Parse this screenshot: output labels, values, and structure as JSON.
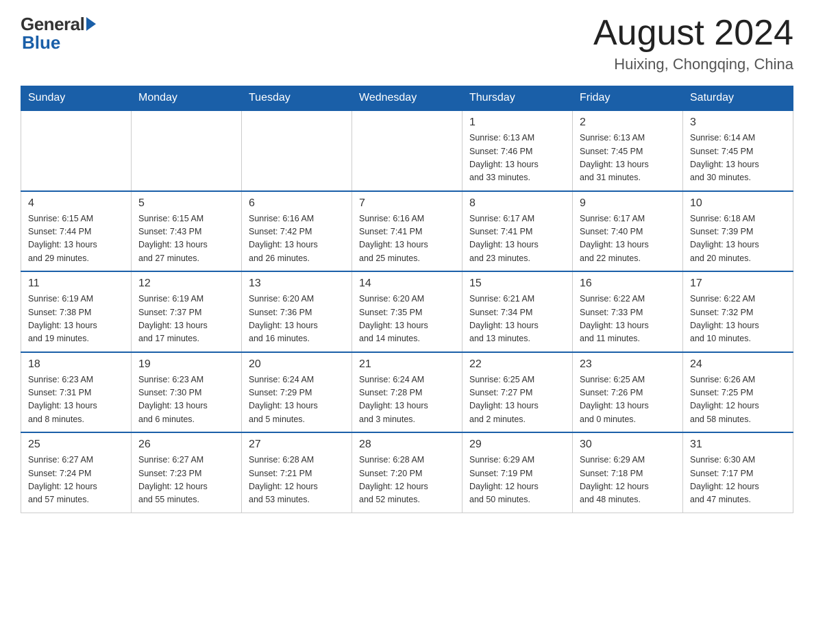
{
  "logo": {
    "general": "General",
    "blue": "Blue"
  },
  "header": {
    "month_year": "August 2024",
    "location": "Huixing, Chongqing, China"
  },
  "weekdays": [
    "Sunday",
    "Monday",
    "Tuesday",
    "Wednesday",
    "Thursday",
    "Friday",
    "Saturday"
  ],
  "weeks": [
    [
      {
        "day": "",
        "info": ""
      },
      {
        "day": "",
        "info": ""
      },
      {
        "day": "",
        "info": ""
      },
      {
        "day": "",
        "info": ""
      },
      {
        "day": "1",
        "info": "Sunrise: 6:13 AM\nSunset: 7:46 PM\nDaylight: 13 hours\nand 33 minutes."
      },
      {
        "day": "2",
        "info": "Sunrise: 6:13 AM\nSunset: 7:45 PM\nDaylight: 13 hours\nand 31 minutes."
      },
      {
        "day": "3",
        "info": "Sunrise: 6:14 AM\nSunset: 7:45 PM\nDaylight: 13 hours\nand 30 minutes."
      }
    ],
    [
      {
        "day": "4",
        "info": "Sunrise: 6:15 AM\nSunset: 7:44 PM\nDaylight: 13 hours\nand 29 minutes."
      },
      {
        "day": "5",
        "info": "Sunrise: 6:15 AM\nSunset: 7:43 PM\nDaylight: 13 hours\nand 27 minutes."
      },
      {
        "day": "6",
        "info": "Sunrise: 6:16 AM\nSunset: 7:42 PM\nDaylight: 13 hours\nand 26 minutes."
      },
      {
        "day": "7",
        "info": "Sunrise: 6:16 AM\nSunset: 7:41 PM\nDaylight: 13 hours\nand 25 minutes."
      },
      {
        "day": "8",
        "info": "Sunrise: 6:17 AM\nSunset: 7:41 PM\nDaylight: 13 hours\nand 23 minutes."
      },
      {
        "day": "9",
        "info": "Sunrise: 6:17 AM\nSunset: 7:40 PM\nDaylight: 13 hours\nand 22 minutes."
      },
      {
        "day": "10",
        "info": "Sunrise: 6:18 AM\nSunset: 7:39 PM\nDaylight: 13 hours\nand 20 minutes."
      }
    ],
    [
      {
        "day": "11",
        "info": "Sunrise: 6:19 AM\nSunset: 7:38 PM\nDaylight: 13 hours\nand 19 minutes."
      },
      {
        "day": "12",
        "info": "Sunrise: 6:19 AM\nSunset: 7:37 PM\nDaylight: 13 hours\nand 17 minutes."
      },
      {
        "day": "13",
        "info": "Sunrise: 6:20 AM\nSunset: 7:36 PM\nDaylight: 13 hours\nand 16 minutes."
      },
      {
        "day": "14",
        "info": "Sunrise: 6:20 AM\nSunset: 7:35 PM\nDaylight: 13 hours\nand 14 minutes."
      },
      {
        "day": "15",
        "info": "Sunrise: 6:21 AM\nSunset: 7:34 PM\nDaylight: 13 hours\nand 13 minutes."
      },
      {
        "day": "16",
        "info": "Sunrise: 6:22 AM\nSunset: 7:33 PM\nDaylight: 13 hours\nand 11 minutes."
      },
      {
        "day": "17",
        "info": "Sunrise: 6:22 AM\nSunset: 7:32 PM\nDaylight: 13 hours\nand 10 minutes."
      }
    ],
    [
      {
        "day": "18",
        "info": "Sunrise: 6:23 AM\nSunset: 7:31 PM\nDaylight: 13 hours\nand 8 minutes."
      },
      {
        "day": "19",
        "info": "Sunrise: 6:23 AM\nSunset: 7:30 PM\nDaylight: 13 hours\nand 6 minutes."
      },
      {
        "day": "20",
        "info": "Sunrise: 6:24 AM\nSunset: 7:29 PM\nDaylight: 13 hours\nand 5 minutes."
      },
      {
        "day": "21",
        "info": "Sunrise: 6:24 AM\nSunset: 7:28 PM\nDaylight: 13 hours\nand 3 minutes."
      },
      {
        "day": "22",
        "info": "Sunrise: 6:25 AM\nSunset: 7:27 PM\nDaylight: 13 hours\nand 2 minutes."
      },
      {
        "day": "23",
        "info": "Sunrise: 6:25 AM\nSunset: 7:26 PM\nDaylight: 13 hours\nand 0 minutes."
      },
      {
        "day": "24",
        "info": "Sunrise: 6:26 AM\nSunset: 7:25 PM\nDaylight: 12 hours\nand 58 minutes."
      }
    ],
    [
      {
        "day": "25",
        "info": "Sunrise: 6:27 AM\nSunset: 7:24 PM\nDaylight: 12 hours\nand 57 minutes."
      },
      {
        "day": "26",
        "info": "Sunrise: 6:27 AM\nSunset: 7:23 PM\nDaylight: 12 hours\nand 55 minutes."
      },
      {
        "day": "27",
        "info": "Sunrise: 6:28 AM\nSunset: 7:21 PM\nDaylight: 12 hours\nand 53 minutes."
      },
      {
        "day": "28",
        "info": "Sunrise: 6:28 AM\nSunset: 7:20 PM\nDaylight: 12 hours\nand 52 minutes."
      },
      {
        "day": "29",
        "info": "Sunrise: 6:29 AM\nSunset: 7:19 PM\nDaylight: 12 hours\nand 50 minutes."
      },
      {
        "day": "30",
        "info": "Sunrise: 6:29 AM\nSunset: 7:18 PM\nDaylight: 12 hours\nand 48 minutes."
      },
      {
        "day": "31",
        "info": "Sunrise: 6:30 AM\nSunset: 7:17 PM\nDaylight: 12 hours\nand 47 minutes."
      }
    ]
  ]
}
